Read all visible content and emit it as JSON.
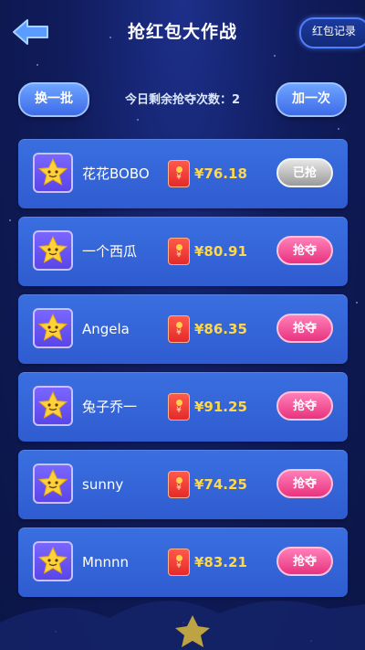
{
  "header": {
    "title": "抢红包大作战",
    "record_label": "红包记录"
  },
  "controls": {
    "swap_label": "换一批",
    "remaining_text": "今日剩余抢夺次数：2",
    "add_label": "加一次"
  },
  "colors": {
    "background": "#101c5c",
    "row": "#3464d8",
    "amount": "#ffd84a",
    "grab_button": "#f0468e",
    "done_button": "#b0b0b0"
  },
  "rows": [
    {
      "name": "花花BOBO",
      "amount": "¥76.18",
      "action": "已抢",
      "state": "done"
    },
    {
      "name": "一个西瓜",
      "amount": "¥80.91",
      "action": "抢夺",
      "state": "grab"
    },
    {
      "name": "Angela",
      "amount": "¥86.35",
      "action": "抢夺",
      "state": "grab"
    },
    {
      "name": "兔子乔一",
      "amount": "¥91.25",
      "action": "抢夺",
      "state": "grab"
    },
    {
      "name": "sunny",
      "amount": "¥74.25",
      "action": "抢夺",
      "state": "grab"
    },
    {
      "name": "Mnnnn",
      "amount": "¥83.21",
      "action": "抢夺",
      "state": "grab"
    }
  ]
}
